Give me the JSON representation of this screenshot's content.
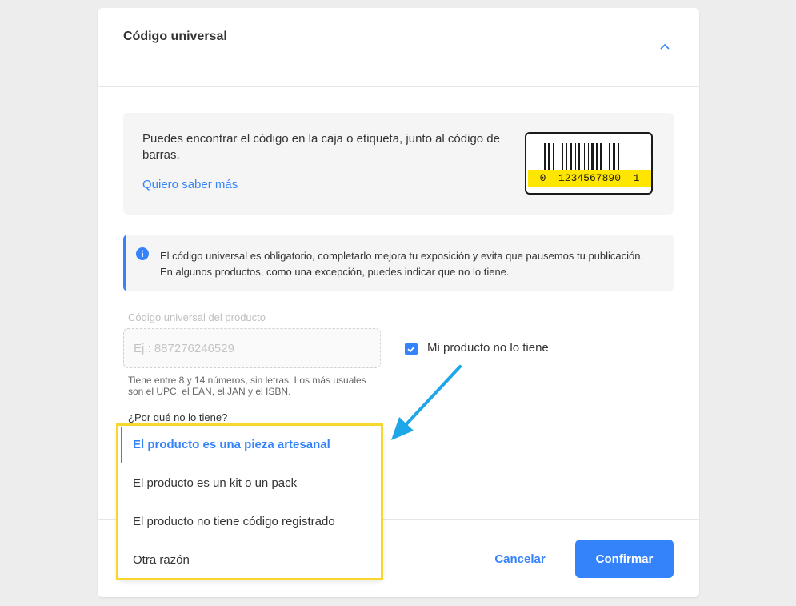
{
  "section": {
    "title": "Código universal",
    "toggle_icon": "chevron-up-icon"
  },
  "info": {
    "text": "Puedes encontrar el código en la caja o etiqueta, junto al código de barras.",
    "link_label": "Quiero saber más",
    "barcode_number": "0  1234567890  1",
    "barcode_icon": "barcode-icon"
  },
  "notice": {
    "icon": "info-icon",
    "text": "El código universal es obligatorio, completarlo mejora tu exposición y evita que pausemos tu publicación. En algunos productos, como una excepción, puedes indicar que no lo tiene."
  },
  "form": {
    "field_label": "Código universal del producto",
    "field_placeholder": "Ej.: 887276246529",
    "field_help": "Tiene entre 8 y 14 números, sin letras. Los más usuales son el UPC, el EAN, el JAN y el ISBN.",
    "checkbox_label": "Mi producto no lo tiene",
    "checkbox_checked": true,
    "reason_label": "¿Por qué no lo tiene?"
  },
  "dropdown": {
    "options": [
      "El producto es una pieza artesanal",
      "El producto es un kit o un pack",
      "El producto no tiene código registrado",
      "Otra razón"
    ],
    "selected_index": 0
  },
  "footer": {
    "cancel_label": "Cancelar",
    "confirm_label": "Confirmar"
  },
  "colors": {
    "accent": "#3483fa",
    "highlight": "#f7d62e",
    "barcode_band": "#ffe600",
    "annotation_arrow": "#1ea7e8"
  }
}
